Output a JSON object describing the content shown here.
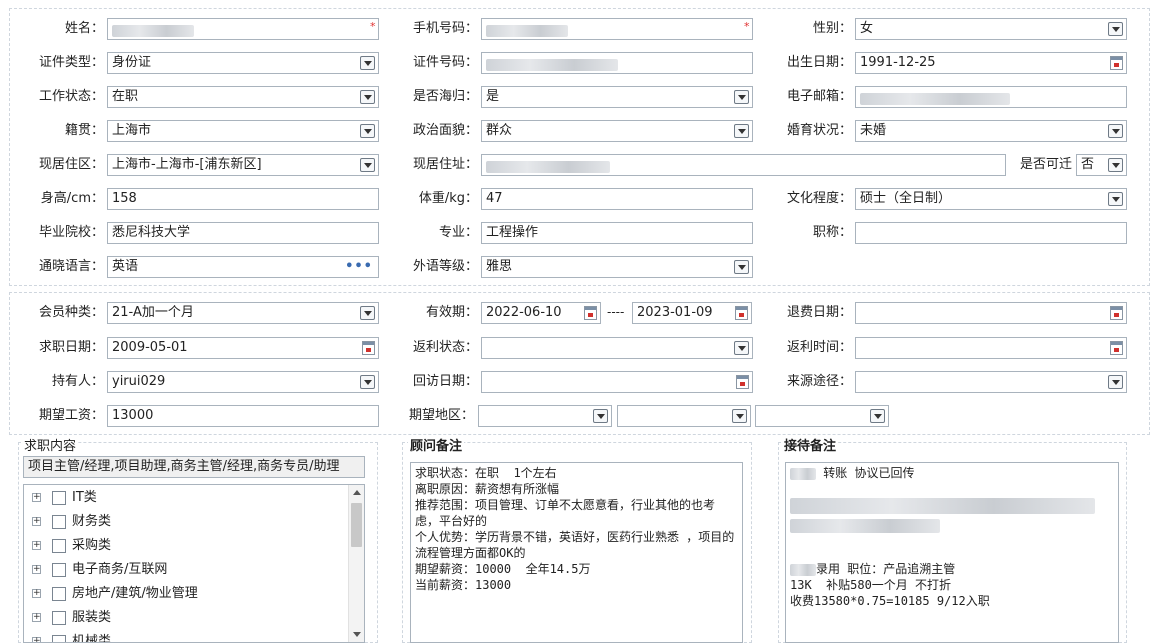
{
  "personal": {
    "name": {
      "label": "姓名：",
      "value": ""
    },
    "phone": {
      "label": "手机号码：",
      "value": ""
    },
    "gender": {
      "label": "性别：",
      "value": "女"
    },
    "id_type": {
      "label": "证件类型：",
      "value": "身份证"
    },
    "id_number": {
      "label": "证件号码：",
      "value": ""
    },
    "birth_date": {
      "label": "出生日期：",
      "value": "1991-12-25"
    },
    "work_status": {
      "label": "工作状态：",
      "value": "在职"
    },
    "returnee": {
      "label": "是否海归：",
      "value": "是"
    },
    "email": {
      "label": "电子邮箱：",
      "value": ""
    },
    "native_place": {
      "label": "籍贯：",
      "value": "上海市"
    },
    "political": {
      "label": "政治面貌：",
      "value": "群众"
    },
    "marital": {
      "label": "婚育状况：",
      "value": "未婚"
    },
    "residence_area": {
      "label": "现居住区：",
      "value": "上海市-上海市-[浦东新区]"
    },
    "address": {
      "label": "现居住址：",
      "value": ""
    },
    "relocate": {
      "label": "是否可迁",
      "value": "否"
    },
    "height": {
      "label": "身高/cm：",
      "value": "158"
    },
    "weight": {
      "label": "体重/kg：",
      "value": "47"
    },
    "education": {
      "label": "文化程度：",
      "value": "硕士（全日制）"
    },
    "school": {
      "label": "毕业院校：",
      "value": "悉尼科技大学"
    },
    "major": {
      "label": "专业：",
      "value": "工程操作"
    },
    "title": {
      "label": "职称：",
      "value": ""
    },
    "languages": {
      "label": "通晓语言：",
      "value": "英语"
    },
    "lang_level": {
      "label": "外语等级：",
      "value": "雅思"
    }
  },
  "membership": {
    "member_type": {
      "label": "会员种类：",
      "value": "21-A加一个月"
    },
    "valid_period": {
      "label": "有效期：",
      "from": "2022-06-10",
      "sep": "----",
      "to": "2023-01-09"
    },
    "refund_date": {
      "label": "退费日期：",
      "value": ""
    },
    "job_date": {
      "label": "求职日期：",
      "value": "2009-05-01"
    },
    "rebate_status": {
      "label": "返利状态：",
      "value": ""
    },
    "rebate_time": {
      "label": "返利时间：",
      "value": ""
    },
    "holder": {
      "label": "持有人：",
      "value": "yirui029"
    },
    "visit_date": {
      "label": "回访日期：",
      "value": ""
    },
    "source": {
      "label": "来源途径：",
      "value": ""
    },
    "salary": {
      "label": "期望工资：",
      "value": "13000"
    },
    "region": {
      "label": "期望地区：",
      "values": [
        "",
        "",
        ""
      ]
    }
  },
  "job_content": {
    "title": "求职内容",
    "summary": "项目主管/经理,项目助理,商务主管/经理,商务专员/助理",
    "tree": [
      "IT类",
      "财务类",
      "采购类",
      "电子商务/互联网",
      "房地产/建筑/物业管理",
      "服装类",
      "机械类"
    ]
  },
  "consultant_notes": {
    "title": "顾问备注",
    "lines": [
      "求职状态：在职  1个左右",
      "离职原因：薪资想有所涨幅",
      "推荐范围：项目管理、订单不太愿意看，行业其他的也考虑，平台好的",
      "个人优势：学历背景不错，英语好，医药行业熟悉 ，项目的流程管理方面都OK的",
      "期望薪资：10000  全年14.5万",
      "当前薪资：13000"
    ]
  },
  "reception_notes": {
    "title": "接待备注",
    "lines": [
      "转账 协议已回传",
      "",
      "",
      "",
      "",
      "",
      "录用 职位：产品追溯主管",
      "13K  补贴580一个月 不打折",
      "收费13580*0.75=10185 9/12入职"
    ]
  },
  "colors": {
    "required": "#e03131",
    "border": "#a9b3bd",
    "dashed": "#cfd6de"
  },
  "icons": [
    "dropdown-arrow-icon",
    "calendar-icon",
    "more-dots-icon",
    "expand-plus-icon",
    "checkbox-icon"
  ]
}
